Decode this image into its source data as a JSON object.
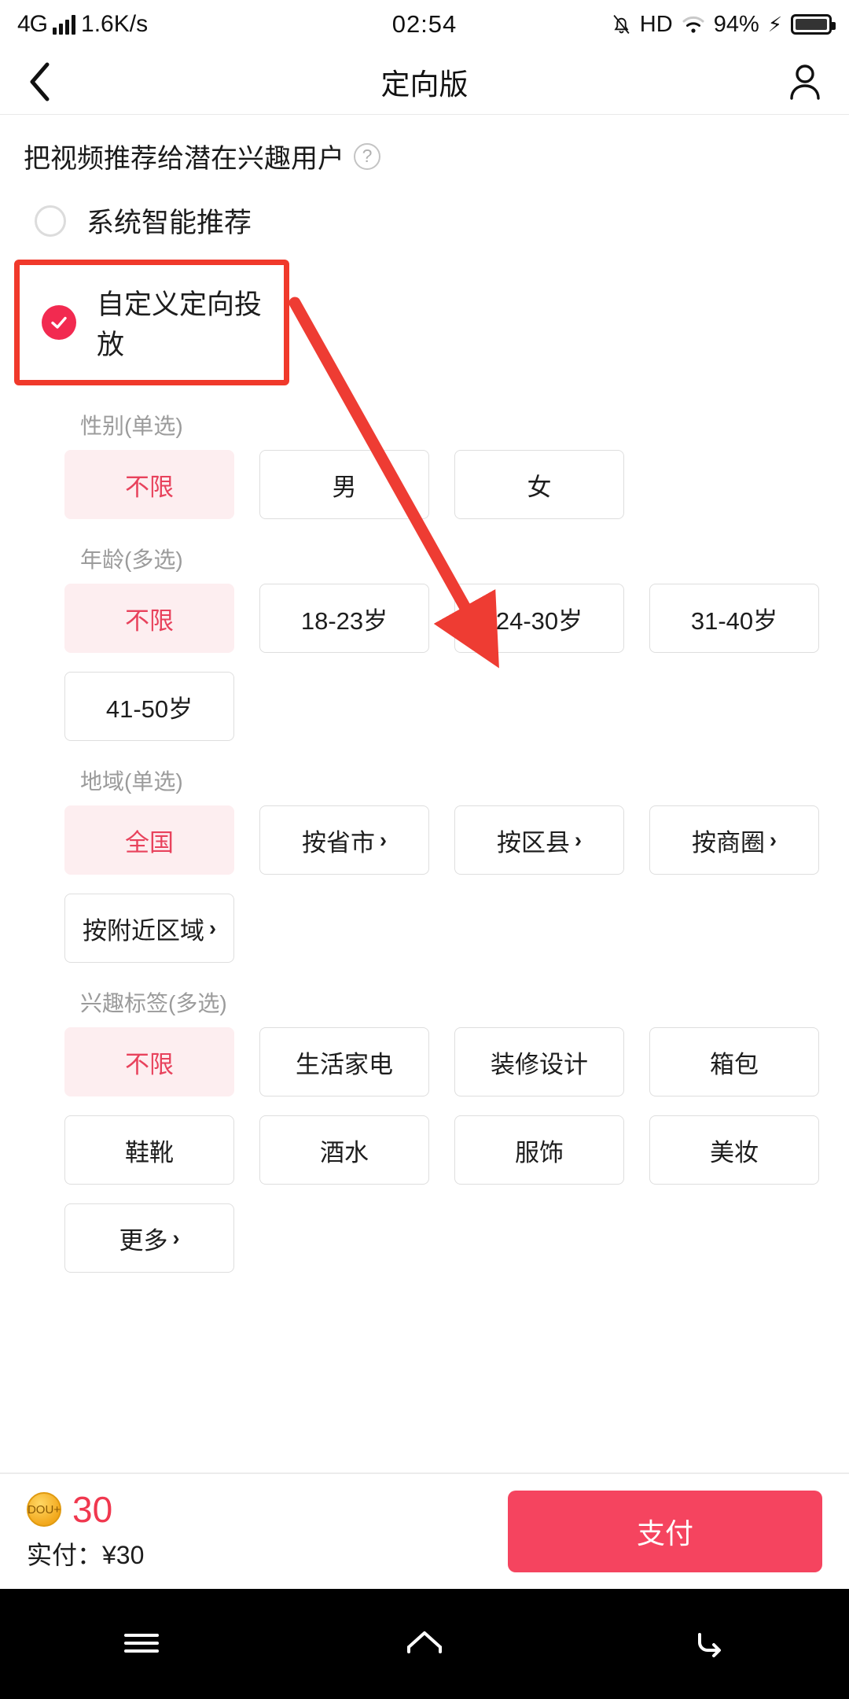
{
  "status_bar": {
    "network": "4G",
    "speed": "1.6K/s",
    "time": "02:54",
    "hd": "HD",
    "battery_percent": "94%",
    "icons": [
      "signal-bars-icon",
      "bell-mute-icon",
      "hd-icon",
      "wifi-icon",
      "charging-bolt-icon",
      "battery-icon"
    ]
  },
  "nav": {
    "back_icon": "back-chevron-icon",
    "title": "定向版",
    "profile_icon": "person-icon"
  },
  "headline": {
    "text": "把视频推荐给潜在兴趣用户",
    "help_icon": "question-mark-icon"
  },
  "mode_options": [
    {
      "label": "系统智能推荐",
      "selected": false
    },
    {
      "label": "自定义定向投放",
      "selected": true
    }
  ],
  "sections": [
    {
      "label": "性别(单选)",
      "name": "gender",
      "options": [
        {
          "label": "不限",
          "selected": true,
          "chevron": false
        },
        {
          "label": "男",
          "selected": false,
          "chevron": false
        },
        {
          "label": "女",
          "selected": false,
          "chevron": false
        }
      ]
    },
    {
      "label": "年龄(多选)",
      "name": "age",
      "options": [
        {
          "label": "不限",
          "selected": true,
          "chevron": false
        },
        {
          "label": "18-23岁",
          "selected": false,
          "chevron": false
        },
        {
          "label": "24-30岁",
          "selected": false,
          "chevron": false
        },
        {
          "label": "31-40岁",
          "selected": false,
          "chevron": false
        },
        {
          "label": "41-50岁",
          "selected": false,
          "chevron": false
        }
      ]
    },
    {
      "label": "地域(单选)",
      "name": "region",
      "options": [
        {
          "label": "全国",
          "selected": true,
          "chevron": false
        },
        {
          "label": "按省市",
          "selected": false,
          "chevron": true
        },
        {
          "label": "按区县",
          "selected": false,
          "chevron": true
        },
        {
          "label": "按商圈",
          "selected": false,
          "chevron": true
        },
        {
          "label": "按附近区域",
          "selected": false,
          "chevron": true
        }
      ]
    },
    {
      "label": "兴趣标签(多选)",
      "name": "interest",
      "options": [
        {
          "label": "不限",
          "selected": true,
          "chevron": false
        },
        {
          "label": "生活家电",
          "selected": false,
          "chevron": false
        },
        {
          "label": "装修设计",
          "selected": false,
          "chevron": false
        },
        {
          "label": "箱包",
          "selected": false,
          "chevron": false
        },
        {
          "label": "鞋靴",
          "selected": false,
          "chevron": false
        },
        {
          "label": "酒水",
          "selected": false,
          "chevron": false
        },
        {
          "label": "服饰",
          "selected": false,
          "chevron": false
        },
        {
          "label": "美妆",
          "selected": false,
          "chevron": false
        },
        {
          "label": "更多",
          "selected": false,
          "chevron": true
        }
      ]
    }
  ],
  "paybar": {
    "coin_icon": "dou-coin-icon",
    "amount": "30",
    "actual_paid": "实付：¥30",
    "pay_button": "支付"
  },
  "android_nav": {
    "recents_icon": "menu-icon",
    "home_icon": "home-icon",
    "back_icon": "back-arrow-icon"
  },
  "annotations": {
    "highlight_color": "#f0392b",
    "arrow_color": "#ee3c33"
  }
}
